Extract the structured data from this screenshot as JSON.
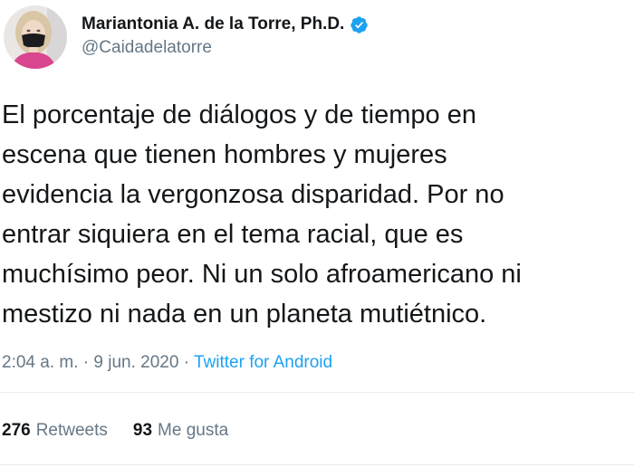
{
  "author": {
    "display_name": "Mariantonia A. de la Torre, Ph.D.",
    "handle": "@Caidadelatorre",
    "verified": true,
    "avatar_icon": "profile-photo-woman-with-face-mask"
  },
  "tweet": {
    "lines": [
      "El porcentaje de diálogos y de tiempo en",
      "escena que tienen hombres y mujeres",
      "evidencia la vergonzosa disparidad. Por no",
      "entrar siquiera en el tema racial, que es",
      "muchísimo peor. Ni un solo afroamericano ni",
      "mestizo ni nada en un planeta mutiétnico."
    ]
  },
  "meta": {
    "time": "2:04 a. m.",
    "separator": "·",
    "date": "9 jun. 2020",
    "source": "Twitter for Android"
  },
  "stats": {
    "retweets_count": "276",
    "retweets_label": "Retweets",
    "likes_count": "93",
    "likes_label": "Me gusta"
  },
  "colors": {
    "text": "#14171a",
    "secondary": "#657786",
    "accent": "#1da1f2",
    "divider": "#e6ecf0"
  }
}
